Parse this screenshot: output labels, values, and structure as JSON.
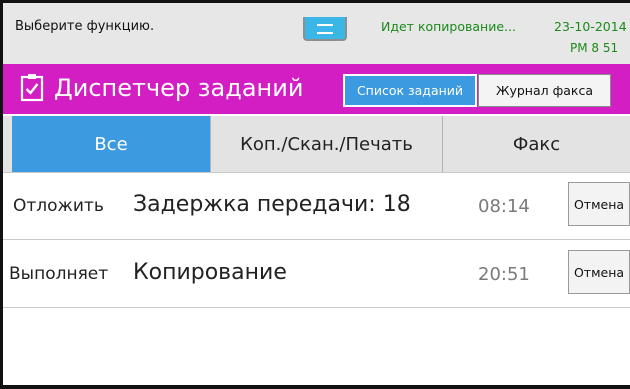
{
  "status_bar": {
    "prompt": "Выберите функцию.",
    "job_status": "Идет копирование...",
    "date": "23-10-2014",
    "time": "PM 8  51"
  },
  "title_bar": {
    "icon": "clipboard-check-icon",
    "title": "Диспетчер заданий",
    "job_list_label": "Список заданий",
    "fax_log_label": "Журнал факса"
  },
  "tabs": [
    {
      "label": "Все",
      "selected": true
    },
    {
      "label": "Коп./Скан./Печать",
      "selected": false
    },
    {
      "label": "Факс",
      "selected": false
    }
  ],
  "jobs": [
    {
      "status": "Отложить",
      "name": "Задержка передачи: 18",
      "time": "08:14",
      "cancel_label": "Отмена"
    },
    {
      "status": "Выполняет",
      "name": "Копирование",
      "time": "20:51",
      "cancel_label": "Отмена"
    }
  ],
  "colors": {
    "title_bar": "#d21ec3",
    "accent": "#3b9ae0",
    "status_text": "#1a8a1a"
  }
}
